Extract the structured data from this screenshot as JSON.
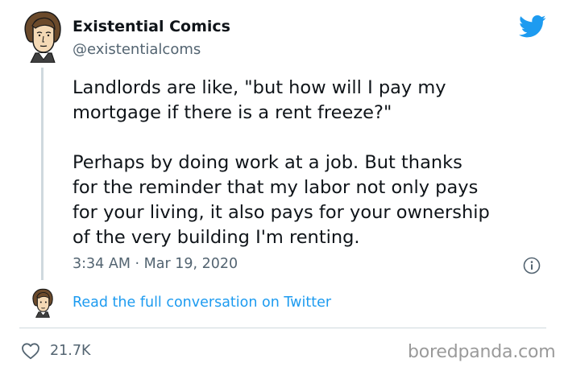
{
  "author": {
    "display_name": "Existential Comics",
    "handle": "@existentialcoms",
    "avatar_icon": "cartoon-portrait-avatar-icon"
  },
  "tweet": {
    "lines_paragraph_1": [
      "Landlords are like, \"but how will I pay my",
      "mortgage if there is a rent freeze?\""
    ],
    "lines_paragraph_2": [
      "Perhaps by doing work at a job. But thanks",
      "for the reminder that my labor not only pays",
      "for your living, it also pays for your ownership",
      "of the very building I'm renting."
    ],
    "timestamp": "3:34 AM · Mar 19, 2020"
  },
  "actions": {
    "read_conversation": "Read the full conversation on Twitter",
    "like_count": "21.7K"
  },
  "icons": {
    "platform": "twitter-bird-icon",
    "info": "info-icon",
    "like": "heart-icon"
  },
  "watermark": "boredpanda.com",
  "colors": {
    "link": "#1d9bf0",
    "secondary_text": "#536471",
    "twitter_blue": "#1d9bf0"
  }
}
